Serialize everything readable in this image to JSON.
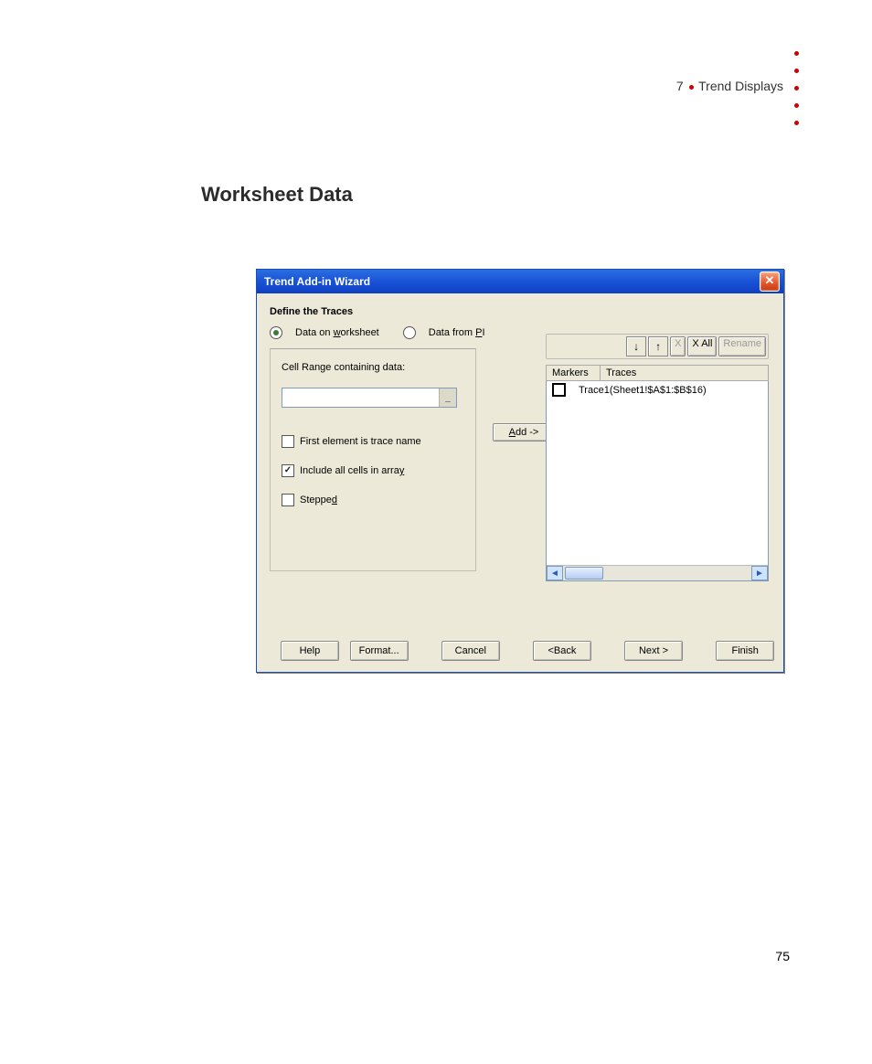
{
  "page": {
    "chapter_number": "7",
    "chapter_title": "Trend Displays",
    "section_title": "Worksheet Data",
    "page_number": "75"
  },
  "dialog": {
    "title": "Trend Add-in Wizard",
    "heading": "Define the Traces",
    "radios": {
      "worksheet": "Data on worksheet",
      "pi": "Data from PI",
      "selected": "worksheet"
    },
    "group": {
      "label": "Cell Range containing data:",
      "combo_value": "",
      "chk_first": "First element is trace name",
      "chk_first_checked": false,
      "chk_include": "Include all cells in array",
      "chk_include_checked": true,
      "chk_stepped": "Stepped",
      "chk_stepped_checked": false
    },
    "add_button": "Add ->",
    "toolbar": {
      "x": "X",
      "x_all": "X All",
      "rename": "Rename"
    },
    "columns": {
      "markers": "Markers",
      "traces": "Traces"
    },
    "rows": [
      {
        "trace": "Trace1(Sheet1!$A$1:$B$16)"
      }
    ],
    "buttons": {
      "help": "Help",
      "format": "Format...",
      "cancel": "Cancel",
      "back": "<Back",
      "next": "Next >",
      "finish": "Finish"
    }
  }
}
